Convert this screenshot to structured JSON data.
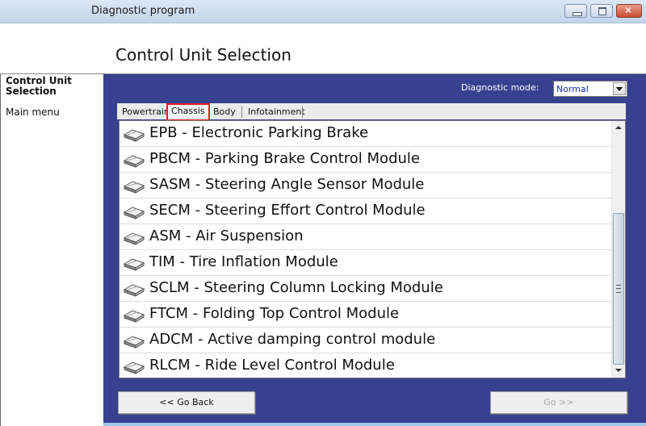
{
  "window": {
    "title": "Diagnostic program",
    "controls": {
      "minimize": "minimize",
      "maximize": "maximize",
      "close": "close"
    }
  },
  "header": {
    "title": "Control Unit Selection"
  },
  "sidebar": {
    "current": "Control Unit Selection",
    "items": [
      {
        "label": "Main menu"
      }
    ]
  },
  "toolbar": {
    "mode_label": "Diagnostic mode:",
    "mode_value": "Normal"
  },
  "tabs": [
    {
      "label": "Powertrain",
      "active": false
    },
    {
      "label": "Chassis",
      "active": true
    },
    {
      "label": "Body",
      "active": false
    },
    {
      "label": "Infotainment",
      "active": false
    }
  ],
  "modules": [
    {
      "label": "EPB - Electronic Parking Brake",
      "icon": "control-unit-icon"
    },
    {
      "label": "PBCM - Parking Brake Control Module",
      "icon": "control-unit-icon"
    },
    {
      "label": "SASM - Steering Angle Sensor Module",
      "icon": "control-unit-icon"
    },
    {
      "label": "SECM - Steering Effort Control Module",
      "icon": "control-unit-icon"
    },
    {
      "label": "ASM - Air Suspension",
      "icon": "control-unit-icon"
    },
    {
      "label": "TIM - Tire Inflation Module",
      "icon": "control-unit-icon"
    },
    {
      "label": "SCLM - Steering Column Locking Module",
      "icon": "control-unit-icon"
    },
    {
      "label": "FTCM - Folding Top Control Module",
      "icon": "control-unit-icon"
    },
    {
      "label": "ADCM - Active damping control module",
      "icon": "control-unit-icon"
    },
    {
      "label": "RLCM - Ride Level Control Module",
      "icon": "control-unit-icon"
    }
  ],
  "buttons": {
    "back": "<< Go Back",
    "go": "Go >>",
    "go_enabled": false
  },
  "colors": {
    "main_bg": "#38418f",
    "active_tab_outline": "#e02020",
    "mode_text": "#1f2fa6"
  }
}
